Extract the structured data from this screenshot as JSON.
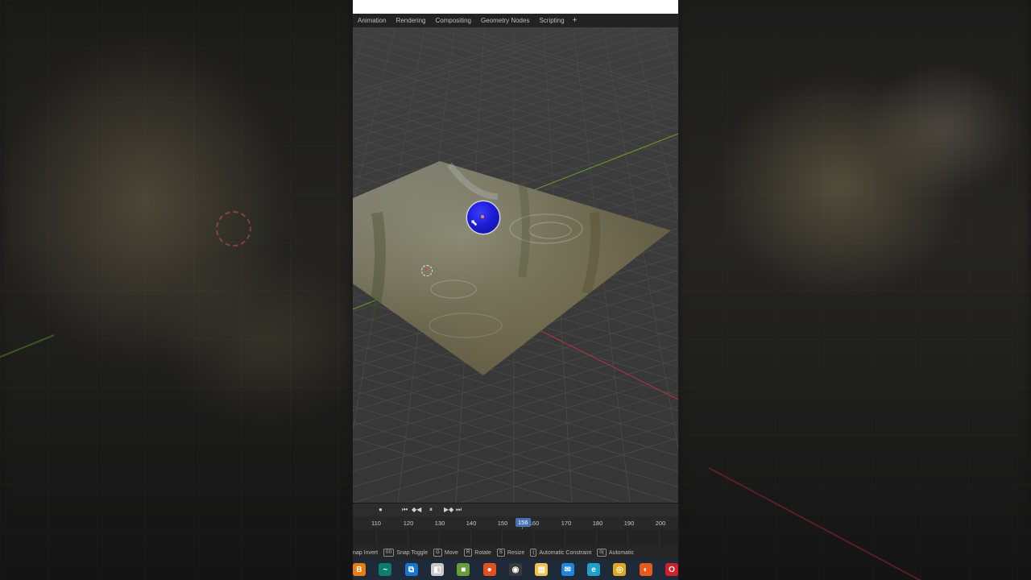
{
  "workspace_tabs": [
    "Animation",
    "Rendering",
    "Compositing",
    "Geometry Nodes",
    "Scripting"
  ],
  "add_workspace_label": "+",
  "timeline": {
    "frame_ticks": [
      "110",
      "120",
      "130",
      "140",
      "150",
      "160",
      "170",
      "180",
      "190",
      "200"
    ],
    "current_frame": "156",
    "controls": {
      "record": "●",
      "jump_start": "⏮",
      "jump_key_prev": "◆◀",
      "pause": "⏸",
      "jump_key_next": "▶◆",
      "jump_end": "⏭"
    }
  },
  "status_bar": {
    "items": [
      {
        "key": "",
        "label": "nap Invert"
      },
      {
        "key": "⌷⌷",
        "label": "Snap Toggle"
      },
      {
        "key": "G",
        "label": "Move"
      },
      {
        "key": "R",
        "label": "Rotate"
      },
      {
        "key": "S",
        "label": "Resize"
      },
      {
        "key": "(",
        "label": "Automatic Constraint"
      },
      {
        "key": "⌷(",
        "label": "Automatic"
      }
    ]
  },
  "taskbar": {
    "apps": [
      {
        "name": "blender",
        "glyph": "B",
        "color": "#e87d0d"
      },
      {
        "name": "terminal",
        "glyph": "~",
        "color": "#0f7b6c"
      },
      {
        "name": "vscode",
        "glyph": "⧉",
        "color": "#1a74d2"
      },
      {
        "name": "files-cube",
        "glyph": "◧",
        "color": "#c9c9c9"
      },
      {
        "name": "minecraft",
        "glyph": "■",
        "color": "#6a9c3a"
      },
      {
        "name": "brave",
        "glyph": "●",
        "color": "#e2501f"
      },
      {
        "name": "obs",
        "glyph": "◉",
        "color": "#3a3a3a"
      },
      {
        "name": "explorer",
        "glyph": "▤",
        "color": "#f2c14e"
      },
      {
        "name": "mail",
        "glyph": "✉",
        "color": "#1f86e0"
      },
      {
        "name": "edge",
        "glyph": "e",
        "color": "#1fa0c8"
      },
      {
        "name": "chrome",
        "glyph": "◎",
        "color": "#e0a81f"
      },
      {
        "name": "firefox",
        "glyph": "◐",
        "color": "#e65a1e"
      },
      {
        "name": "opera",
        "glyph": "O",
        "color": "#d21f2c"
      }
    ]
  },
  "colors": {
    "accent": "#4772b3",
    "x_axis": "#b8323e",
    "y_axis": "#6a9c2a",
    "sphere": "#1d1dd8"
  }
}
